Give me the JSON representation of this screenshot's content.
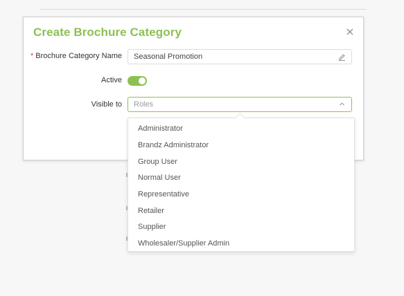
{
  "dialog": {
    "title": "Create Brochure Category",
    "close_icon": "close-icon"
  },
  "form": {
    "name_field": {
      "required_mark": "*",
      "label": "Brochure Category Name",
      "value": "Seasonal Promotion",
      "icon": "edit-icon"
    },
    "active_field": {
      "label": "Active",
      "checked": true
    },
    "visible_field": {
      "label": "Visible to",
      "placeholder": "Roles",
      "expanded": true
    }
  },
  "roles_dropdown": {
    "options": [
      "Administrator",
      "Brandz Administrator",
      "Group User",
      "Normal User",
      "Representative",
      "Retailer",
      "Supplier",
      "Wholesaler/Supplier Admin"
    ]
  },
  "colors": {
    "accent": "#8cc152",
    "required": "#e53935"
  }
}
